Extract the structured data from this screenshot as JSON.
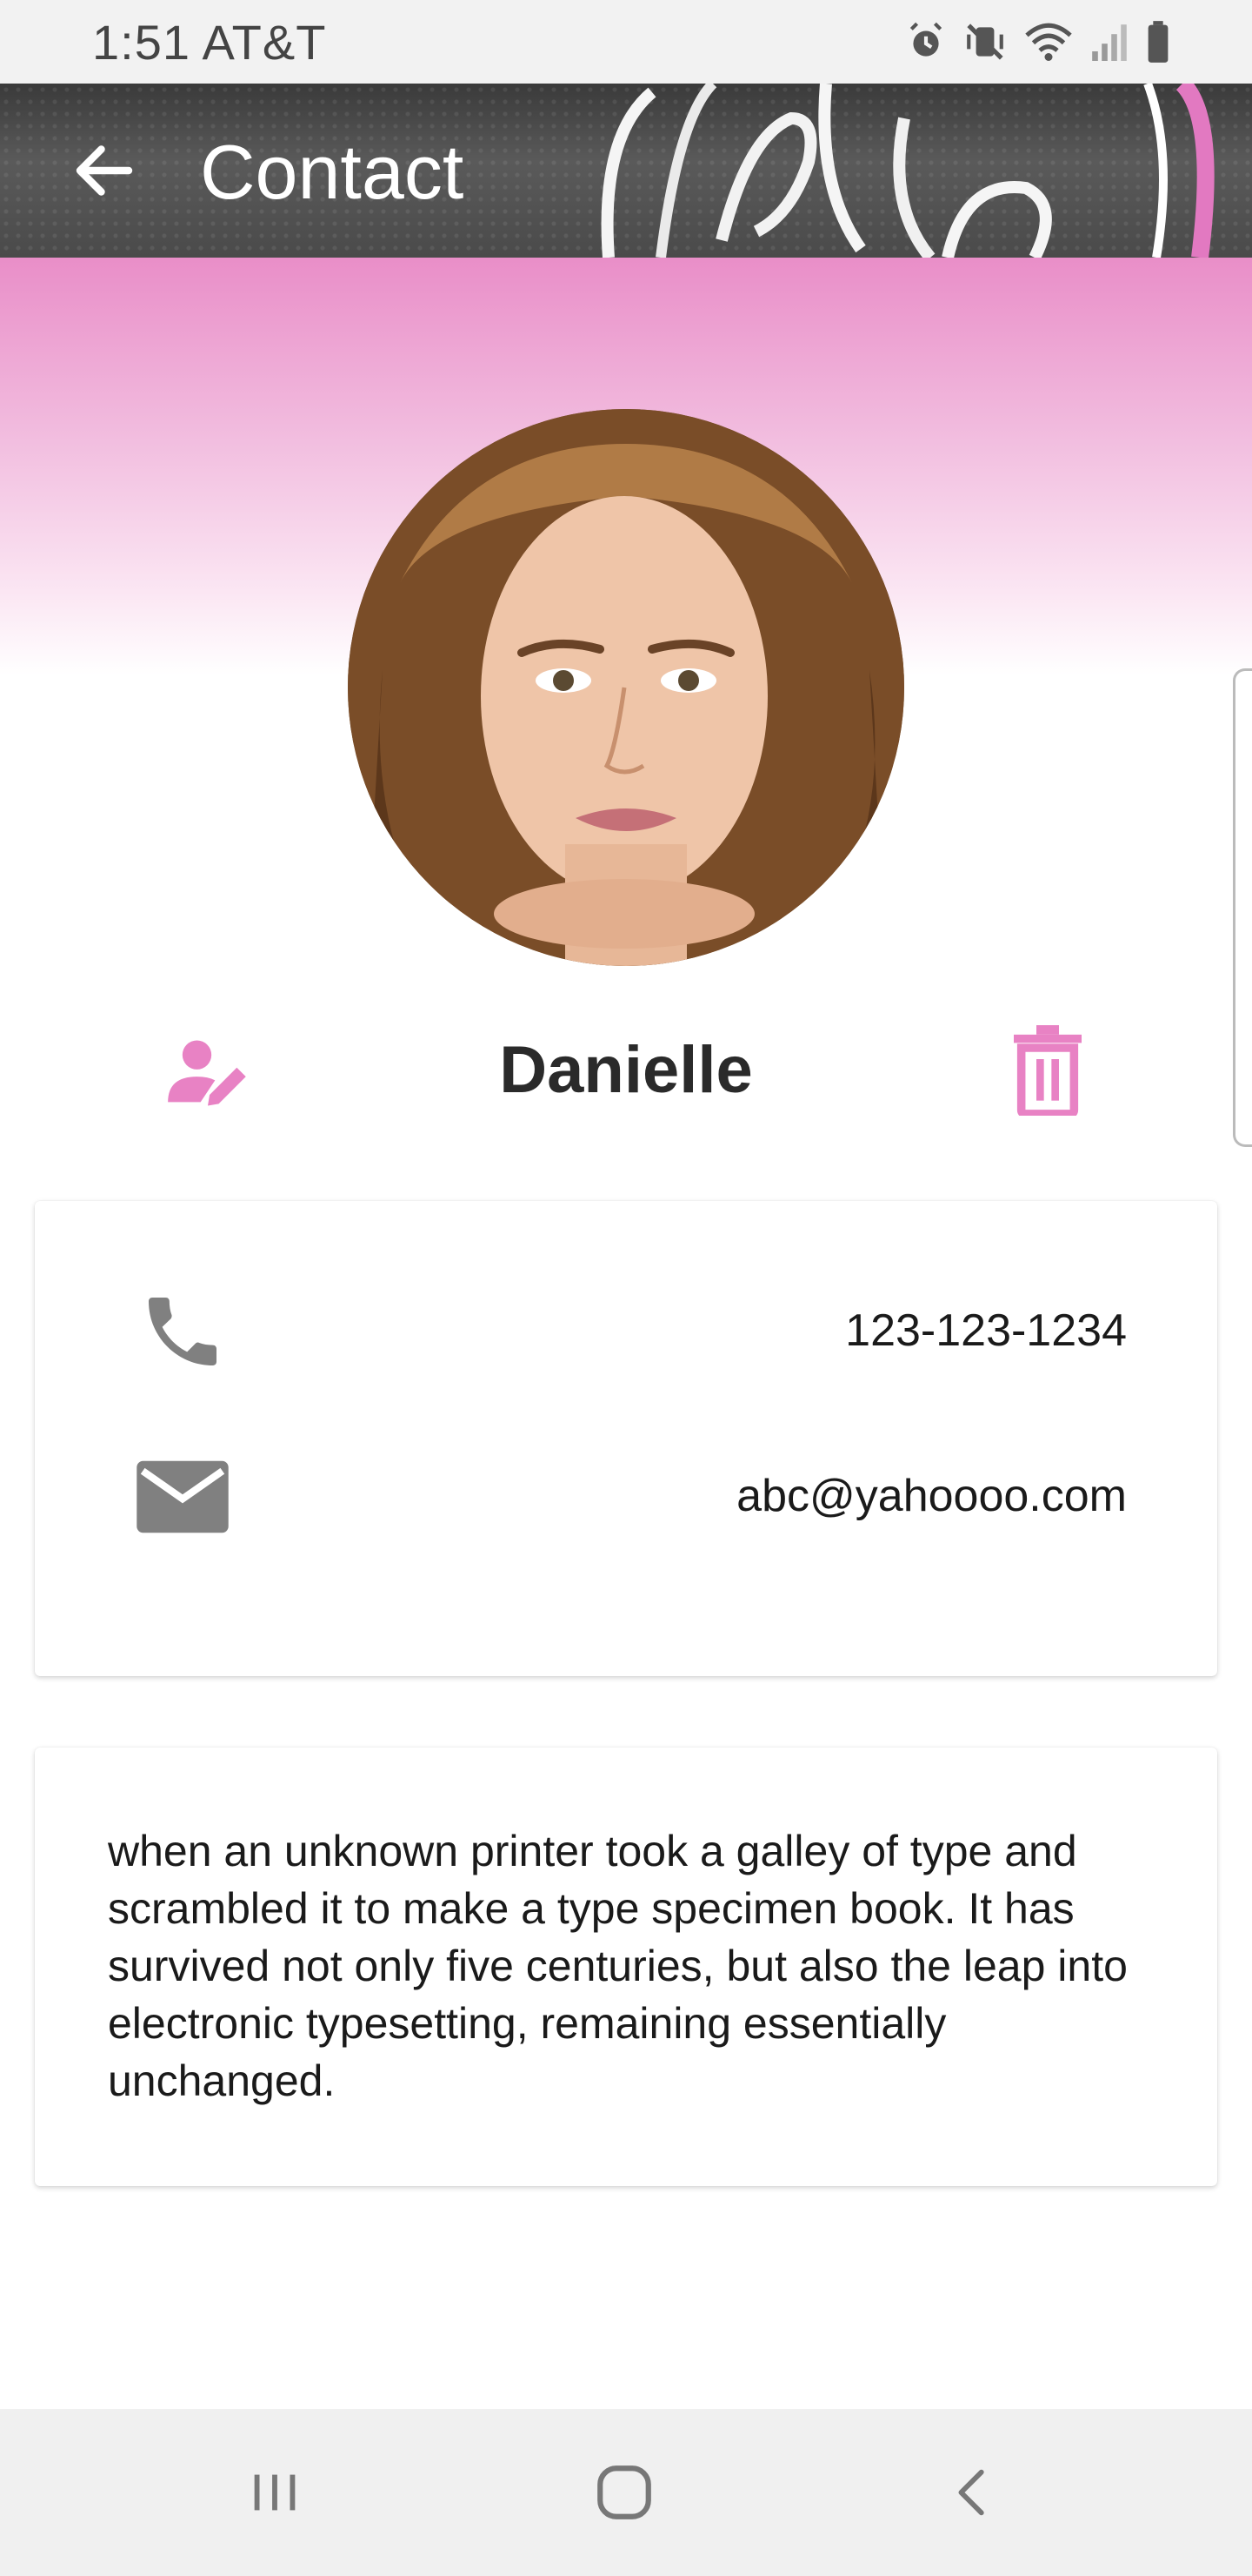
{
  "status_bar": {
    "time_carrier": "1:51 AT&T",
    "icons": [
      "alarm-icon",
      "vibrate-mute-icon",
      "wifi-icon",
      "signal-icon",
      "battery-icon"
    ]
  },
  "header": {
    "title": "Contact",
    "back_icon": "arrow-left-icon",
    "background_sign": "hello"
  },
  "contact": {
    "name": "Danielle",
    "phone": "123-123-1234",
    "email": "abc@yahoooo.com",
    "about": "when an unknown printer took a galley of type and scrambled it to make a type specimen book. It has survived not only five centuries, but also the leap into electronic typesetting, remaining essentially unchanged."
  },
  "actions": {
    "edit_icon": "edit-person-icon",
    "delete_icon": "trash-icon",
    "phone_icon": "phone-icon",
    "email_icon": "mail-icon"
  },
  "nav_bar": {
    "items": [
      "recents-icon",
      "home-icon",
      "back-icon"
    ]
  },
  "colors": {
    "accent": "#e882c4",
    "icon_gray": "#808080",
    "hero_top": "#e98ec8"
  }
}
